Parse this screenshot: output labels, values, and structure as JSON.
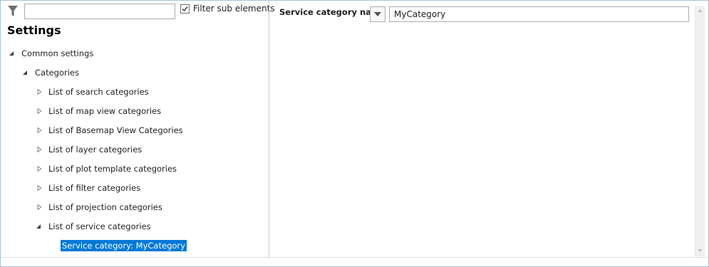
{
  "toolbar": {
    "filter_icon": "filter-icon",
    "search_value": "",
    "search_placeholder": "",
    "filter_sub_elements_label": "Filter sub elements",
    "filter_sub_elements_checked": true
  },
  "settings_title": "Settings",
  "tree": {
    "items": [
      {
        "label": "Common settings",
        "state": "expanded",
        "level": 0
      },
      {
        "label": "Categories",
        "state": "expanded",
        "level": 1
      },
      {
        "label": "List of search categories",
        "state": "collapsed",
        "level": 2
      },
      {
        "label": "List of map view categories",
        "state": "collapsed",
        "level": 2
      },
      {
        "label": "List of Basemap View Categories",
        "state": "collapsed",
        "level": 2
      },
      {
        "label": "List of layer categories",
        "state": "collapsed",
        "level": 2
      },
      {
        "label": "List of plot template categories",
        "state": "collapsed",
        "level": 2
      },
      {
        "label": "List of filter categories",
        "state": "collapsed",
        "level": 2
      },
      {
        "label": "List of projection categories",
        "state": "collapsed",
        "level": 2
      },
      {
        "label": "List of service categories",
        "state": "expanded",
        "level": 2
      },
      {
        "label": "Service category: MyCategory",
        "state": "leaf",
        "level": 3,
        "selected": true
      }
    ]
  },
  "detail": {
    "field_label": "Service category name",
    "field_value": "MyCategory"
  },
  "colors": {
    "selection": "#0078d7",
    "border": "#abadb3"
  }
}
